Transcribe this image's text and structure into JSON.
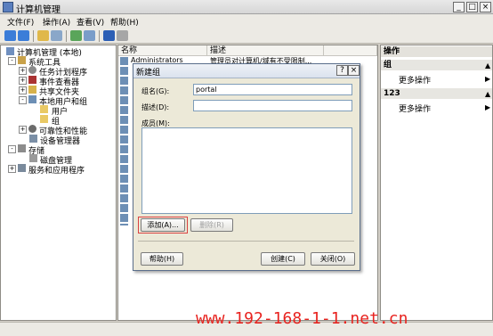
{
  "window": {
    "title": "计算机管理",
    "minimize": "_",
    "maximize": "□",
    "close": "×"
  },
  "menu": {
    "items": [
      "文件(F)",
      "操作(A)",
      "查看(V)",
      "帮助(H)"
    ]
  },
  "tree": {
    "items": [
      {
        "label": "计算机管理 (本地)"
      },
      {
        "label": "系统工具",
        "exp": "-"
      },
      {
        "label": "任务计划程序",
        "exp": "+"
      },
      {
        "label": "事件查看器",
        "exp": "+"
      },
      {
        "label": "共享文件夹",
        "exp": "+"
      },
      {
        "label": "本地用户和组",
        "exp": "-"
      },
      {
        "label": "用户"
      },
      {
        "label": "组"
      },
      {
        "label": "可靠性和性能",
        "exp": "+"
      },
      {
        "label": "设备管理器"
      },
      {
        "label": "存储",
        "exp": "-"
      },
      {
        "label": "磁盘管理"
      },
      {
        "label": "服务和应用程序",
        "exp": "+"
      }
    ]
  },
  "list": {
    "col_name": "名称",
    "col_desc": "描述",
    "row0_name": "Administrators",
    "row0_desc": "管理员对计算机/域有不受限制..."
  },
  "actions": {
    "header": "操作",
    "group1": "组",
    "more1": "更多操作",
    "group2": "123",
    "more2": "更多操作"
  },
  "dialog": {
    "title": "新建组",
    "help_glyph": "?",
    "close_glyph": "×",
    "name_label": "组名(G):",
    "name_value": "portal",
    "desc_label": "描述(D):",
    "desc_value": "",
    "members_label": "成员(M):",
    "add_label": "添加(A)...",
    "remove_label": "删除(R)",
    "help_label": "帮助(H)",
    "create_label": "创建(C)",
    "close_label": "关闭(O)"
  },
  "watermark": "www.192-168-1-1.net.cn",
  "colors": {
    "highlight": "#d94141",
    "watermark": "#e8231f"
  }
}
